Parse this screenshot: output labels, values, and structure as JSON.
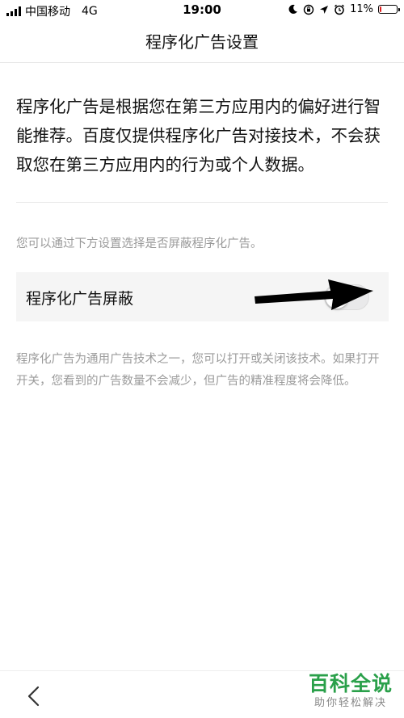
{
  "status_bar": {
    "carrier": "中国移动",
    "network": "4G",
    "time": "19:00",
    "battery": "11%",
    "battery_level": 0.11,
    "battery_color": "#e02020"
  },
  "nav": {
    "title": "程序化广告设置"
  },
  "intro_text": "程序化广告是根据您在第三方应用内的偏好进行智能推荐。百度仅提供程序化广告对接技术，不会获取您在第三方应用内的行为或个人数据。",
  "hint_text": "您可以通过下方设置选择是否屏蔽程序化广告。",
  "setting": {
    "label": "程序化广告屏蔽",
    "enabled": false
  },
  "description": "程序化广告为通用广告技术之一，您可以打开或关闭该技术。如果打开开关，您看到的广告数量不会减少，但广告的精准程度将会降低。",
  "icons": {
    "back": "chevron-left-icon",
    "arrow": "arrow-right-icon",
    "moon": "moon-icon",
    "lock_rotation": "orientation-lock-icon",
    "location": "location-arrow-icon",
    "alarm": "alarm-icon"
  },
  "watermark": {
    "title": "百科全说",
    "subtitle": "助你轻松解决",
    "color": "#2aa04a"
  }
}
